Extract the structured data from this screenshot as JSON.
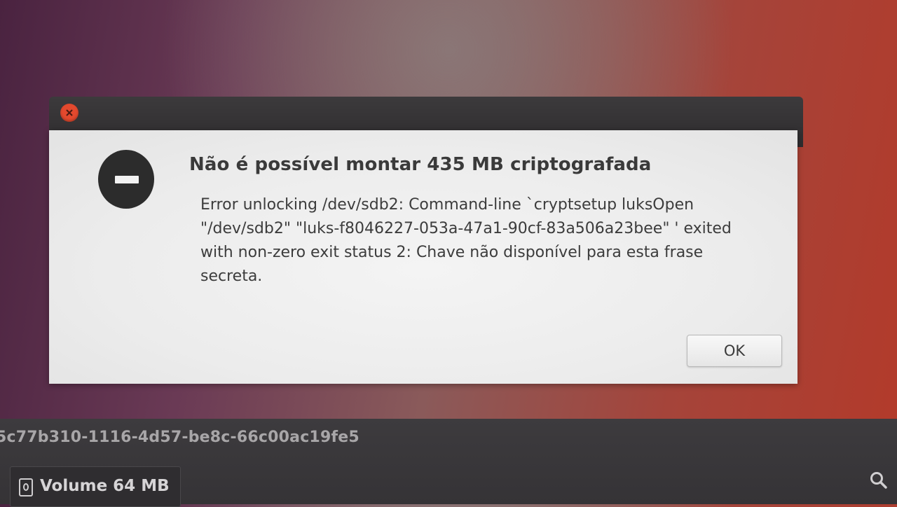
{
  "dialog": {
    "title": "Não é possível montar 435 MB criptografada",
    "message": "Error unlocking /dev/sdb2: Command-line `cryptsetup luksOpen \"/dev/sdb2\" \"luks-f8046227-053a-47a1-90cf-83a506a23bee\" ' exited with non-zero exit status 2: Chave não disponível para esta frase secreta.",
    "ok_label": "OK",
    "close_icon": "close-icon",
    "status_icon": "error-icon"
  },
  "desktop": {
    "uuid_text": "5c77b310-1116-4d57-be8c-66c00ac19fe5",
    "volume_label": "Volume 64 MB",
    "volume_icon": "drive-icon",
    "search_icon": "search-icon"
  },
  "colors": {
    "close_button": "#e3492e",
    "dialog_background": "#ececec",
    "titlebar": "#2e2c2e"
  }
}
